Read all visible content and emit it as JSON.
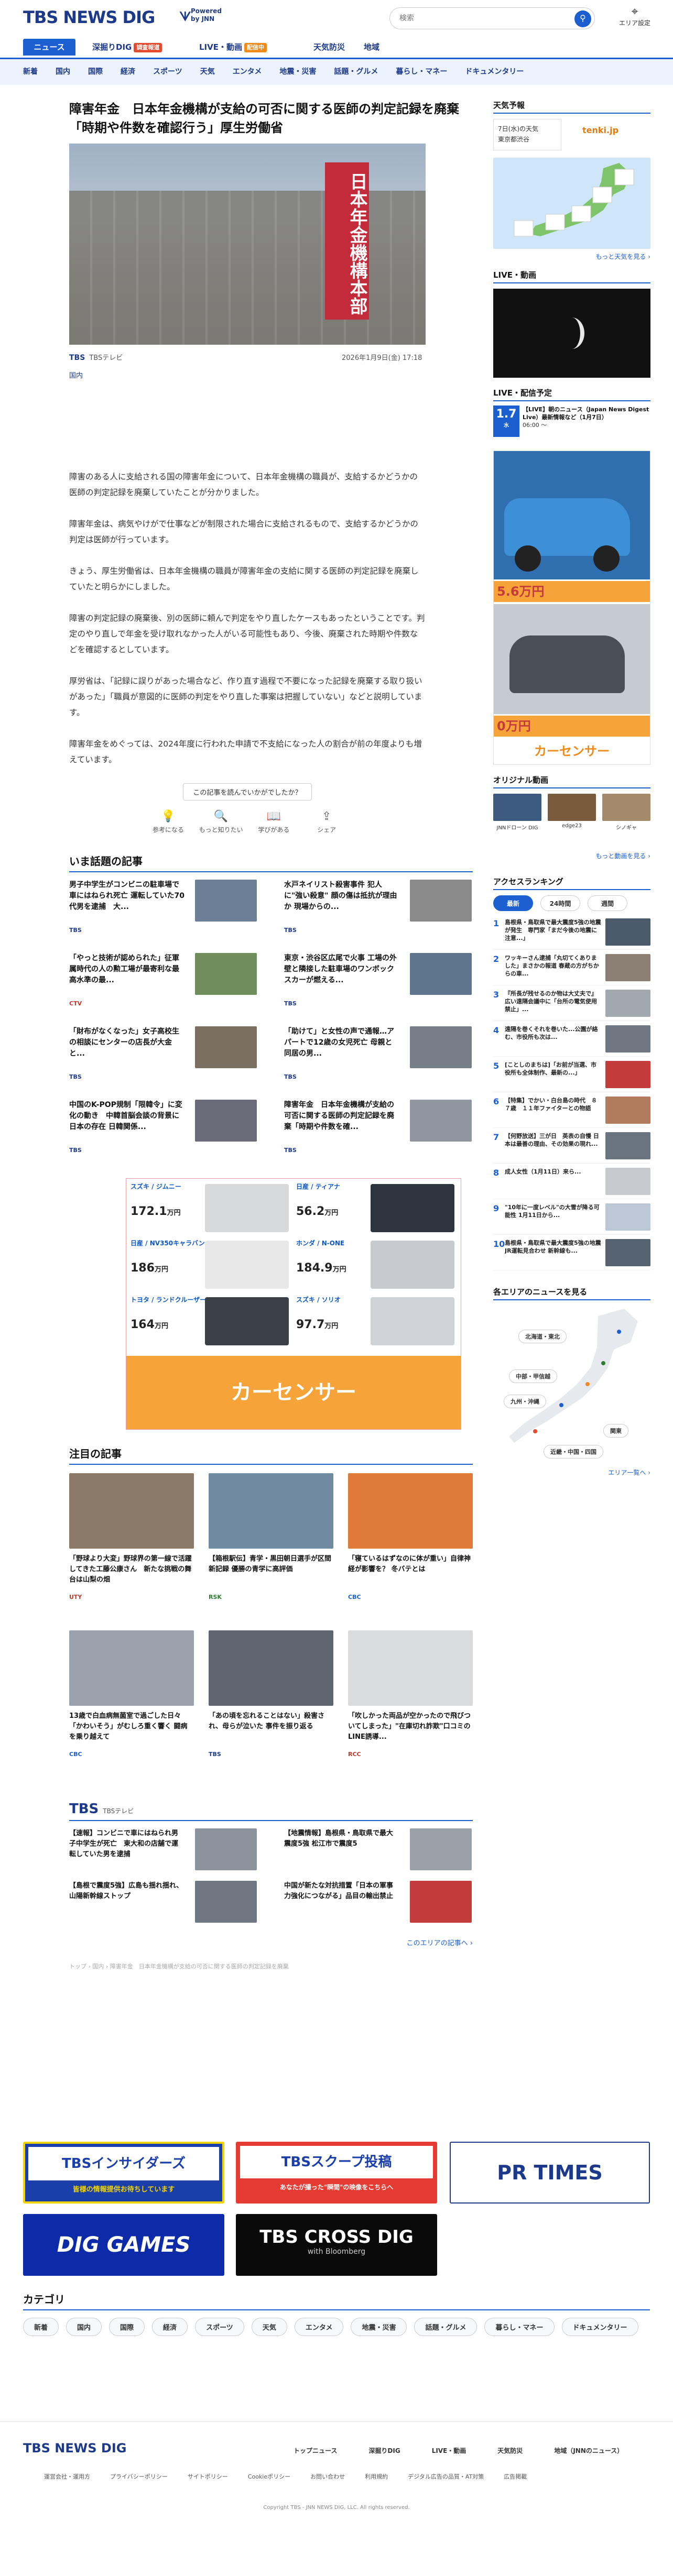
{
  "header": {
    "logo": "TBS NEWS DIG",
    "logo_sub1": "Powered",
    "logo_sub2": "by JNN",
    "search_placeholder": "検索",
    "area_label": "エリア設定",
    "nav1": [
      {
        "label": "ニュース"
      },
      {
        "label": "深掘りDIG",
        "badge": "調査報道"
      },
      {
        "label": "LIVE・動画",
        "badge": "配信中"
      },
      {
        "label": "天気防災"
      },
      {
        "label": "地域"
      }
    ],
    "nav2": [
      "新着",
      "国内",
      "国際",
      "経済",
      "スポーツ",
      "天気",
      "エンタメ",
      "地震・災害",
      "話題・グルメ",
      "暮らし・マネー",
      "ドキュメンタリー"
    ]
  },
  "article": {
    "title": "障害年金　日本年金機構が支給の可否に関する医師の判定記録を廃棄「時期や件数を確認行う」厚生労働省",
    "photo_sign": "日本年金機構本部",
    "source_logo": "TBS",
    "source": "TBSテレビ",
    "date": "2026年1月9日(金) 17:18",
    "tag": "国内",
    "paragraphs": [
      "障害のある人に支給される国の障害年金について、日本年金機構の職員が、支給するかどうかの医師の判定記録を廃棄していたことが分かりました。",
      "障害年金は、病気やけがで仕事などが制限された場合に支給されるもので、支給するかどうかの判定は医師が行っています。",
      "きょう、厚生労働省は、日本年金機構の職員が障害年金の支給に関する医師の判定記録を廃棄していたと明らかにしました。",
      "障害の判定記録の廃棄後、別の医師に頼んで判定をやり直したケースもあったということです。判定のやり直しで年金を受け取れなかった人がいる可能性もあり、今後、廃棄された時期や件数などを確認するとしています。",
      "厚労省は、「記録に誤りがあった場合など、作り直す過程で不要になった記録を廃棄する取り扱いがあった」「職員が意図的に医師の判定をやり直した事案は把握していない」などと説明しています。",
      "障害年金をめぐっては、2024年度に行われた申請で不支給になった人の割合が前の年度よりも増えています。"
    ],
    "reaction_question": "この記事を読んでいかがでしたか？",
    "reactions": [
      {
        "icon": "lightbulb-icon",
        "glyph": "💡",
        "label": "参考になる"
      },
      {
        "icon": "search-icon",
        "glyph": "🔍",
        "label": "もっと知りたい"
      },
      {
        "icon": "book-icon",
        "glyph": "📖",
        "label": "学びがある"
      },
      {
        "icon": "share-icon",
        "glyph": "⇪",
        "label": "シェア"
      }
    ]
  },
  "topics": {
    "heading": "いま話題の記事",
    "items": [
      {
        "title": "男子中学生がコンビニの駐車場で車にはねられ死亡 運転していた70代男を逮捕　大...",
        "source": "TBS",
        "time": "",
        "color": "#6d7f96",
        "src_color": "#1d3a8a"
      },
      {
        "title": "水戸ネイリスト殺害事件 犯人に\"強い殺意\" 顔の傷は抵抗が理由か 現場からの...",
        "source": "TBS",
        "time": "",
        "color": "#8a8a8a",
        "src_color": "#1d3a8a"
      },
      {
        "title": "「やっと技術が認められた」征軍属時代の人の勲工場が最寄利な最高水準の最...",
        "source": "CTV",
        "time": "",
        "color": "#6f8e5c",
        "src_color": "#c0392b"
      },
      {
        "title": "東京・渋谷区広尾で火事 工場の外壁と隣接した駐車場のワンボックスカーが燃える...",
        "source": "TBS",
        "time": "",
        "color": "#5e7590",
        "src_color": "#1d3a8a"
      },
      {
        "title": "「財布がなくなった」女子高校生の相談にセンターの店長が大金と...",
        "source": "TBS",
        "time": "",
        "color": "#7b6f62",
        "src_color": "#1d3a8a"
      },
      {
        "title": "「助けて」と女性の声で通報…アパートで12歳の女児死亡 母親と同居の男...",
        "source": "TBS",
        "time": "",
        "color": "#767e88",
        "src_color": "#1d3a8a"
      },
      {
        "title": "中国のK-POP規制「限韓令」に変化の動き　中韓首脳会談の背景に日本の存在 日韓関係...",
        "source": "TBS",
        "time": "",
        "color": "#6b6a78",
        "src_color": "#1d3a8a"
      },
      {
        "title": "障害年金　日本年金機構が支給の可否に関する医師の判定記録を廃棄「時期や件数を確...",
        "source": "TBS",
        "time": "",
        "color": "#8f96a0",
        "src_color": "#1d3a8a"
      }
    ]
  },
  "ad_main": {
    "cells": [
      {
        "name": "スズキ / ジムニー",
        "price": "172.1",
        "unit": "万円",
        "color": "#d7d9db"
      },
      {
        "name": "日産 / ティアナ",
        "price": "56.2",
        "unit": "万円",
        "color": "#2d3440"
      },
      {
        "name": "日産 / NV350キャラバン",
        "price": "186",
        "unit": "万円",
        "color": "#e8e8e8"
      },
      {
        "name": "ホンダ / N-ONE",
        "price": "184.9",
        "unit": "万円",
        "color": "#c7cbd0"
      },
      {
        "name": "トヨタ / ランドクルーザー",
        "price": "164",
        "unit": "万円",
        "color": "#3b3f46"
      },
      {
        "name": "スズキ / ソリオ",
        "price": "97.7",
        "unit": "万円",
        "color": "#cfd3d8"
      }
    ],
    "logo": "カーセンサー"
  },
  "featured": {
    "heading": "注目の記事",
    "items": [
      {
        "title": "「野球より大変」野球界の第一線で活躍してきた工藤公康さん　新たな挑戦の舞台は山梨の畑",
        "source": "UTY",
        "time": "",
        "color": "#8c7a68",
        "src_color": "#c0392b"
      },
      {
        "title": "【箱根駅伝】青学・黒田朝日選手が区間新記録 優勝の青学に高評価",
        "source": "RSK",
        "time": "",
        "color": "#6f8aa1",
        "src_color": "#2e7d32"
      },
      {
        "title": "「寝ているはずなのに体が重い」自律神経が影響を？ 冬バテとは",
        "source": "CBC",
        "time": "",
        "color": "#e07a3a",
        "src_color": "#1b5fd1"
      },
      {
        "title": "13歳で白血病無菌室で過ごした日々「かわいそう」がむしろ重く響く 闘病を乗り越えて",
        "source": "CBC",
        "time": "",
        "color": "#9aa3ad",
        "src_color": "#1b5fd1"
      },
      {
        "title": "「あの頃を忘れることはない」殺害され、母らが泣いた 事件を振り返る",
        "source": "TBS",
        "time": "",
        "color": "#5f6670",
        "src_color": "#1d3a8a"
      },
      {
        "title": "「吹しかった両品が空かったので飛びついてしまった」\"在庫切れ詐欺\"口コミのLINE誘導...",
        "source": "RCC",
        "time": "",
        "color": "#d9dbdd",
        "src_color": "#c0392b"
      }
    ]
  },
  "tbs_local": {
    "logo": "TBS",
    "label": "TBSテレビ",
    "items": [
      {
        "title": "【速報】コンビニで車にはねられ男子中学生が死亡　東大和の店舗で運転していた男を逮捕",
        "color": "#8b939c"
      },
      {
        "title": "【地震情報】島根県・鳥取県で最大震度5強 松江市で震度5",
        "color": "#9aa0a8"
      },
      {
        "title": "【島根で震度5強】広島も揺れ揺れ、山陽新幹線ストップ",
        "color": "#6e7682"
      },
      {
        "title": "中国が新たな対抗措置「日本の軍事力強化につながる」品目の輸出禁止",
        "color": "#c43b3b"
      }
    ],
    "more": "このエリアの記事へ ›"
  },
  "breadcrumb": "トップ › 国内 › 障害年金　日本年金機構が支給の可否に関する医師の判定記録を廃棄",
  "banners": [
    {
      "label": "TBSインサイダーズ",
      "sub": "皆様の情報提供お待ちしています"
    },
    {
      "label": "TBSスクープ投稿",
      "sub": "あなたが撮った\"瞬間\"の映像をこちらへ"
    },
    {
      "label": "PR TIMES",
      "sub": ""
    },
    {
      "label": "DIG GAMES",
      "sub": ""
    },
    {
      "label": "TBS CROSS DIG",
      "sub": "with Bloomberg"
    }
  ],
  "categories": {
    "heading": "カテゴリ",
    "items": [
      "新着",
      "国内",
      "国際",
      "経済",
      "スポーツ",
      "天気",
      "エンタメ",
      "地震・災害",
      "話題・グルメ",
      "暮らし・マネー",
      "ドキュメンタリー"
    ]
  },
  "footer": {
    "logo": "TBS NEWS DIG",
    "links1": [
      "トップニュース",
      "深掘りDIG",
      "LIVE・動画",
      "天気防災",
      "地域（JNNのニュース）"
    ],
    "links2": [
      "運営会社・運用方",
      "プライバシーポリシー",
      "サイトポリシー",
      "Cookieポリシー",
      "お問い合わせ",
      "利用規約",
      "デジタル広告の品質・AT対策",
      "広告掲載"
    ],
    "copyright": "Copyright TBS - JNN NEWS DIG, LLC. All rights reserved."
  },
  "sidebar": {
    "weather": {
      "heading": "天気予報",
      "tab1": "7日(水)の天気",
      "tab2": "東京都渋谷",
      "logo": "tenki.jp",
      "more": "もっと天気を見る ›"
    },
    "live": {
      "heading": "LIVE・動画",
      "sched_heading": "LIVE・配信予定",
      "sched_day": "1.7",
      "sched_wd": "水",
      "sched_title": "【LIVE】朝のニュース（Japan News Digest Live）最新情報など（1月7日）",
      "sched_time": "06:00 〜"
    },
    "originals": {
      "heading": "オリジナル動画",
      "items": [
        {
          "label": "JNNドローン DIG",
          "color": "#3d5a80"
        },
        {
          "label": "edge23",
          "color": "#7a5c3c"
        },
        {
          "label": "シノギャ",
          "color": "#a48a6a"
        }
      ],
      "more": "もっと動画を見る ›"
    },
    "ranking": {
      "heading": "アクセスランキング",
      "tabs": [
        "最新",
        "24時間",
        "週間"
      ],
      "items": [
        {
          "title": "島根県・鳥取県で最大震度5強の地震が発生　専門家「まだ今後の地震に注意...」",
          "color": "#4a5a6b"
        },
        {
          "title": "ワッキーさん逮捕「丸切てくありました」まさかの報道 春蔵の方がちからの車...",
          "color": "#8a7f72"
        },
        {
          "title": "『所長が残せるのか物は大丈夫で』広い遠隔会議中に「台所の電気使用禁止」...",
          "color": "#a3a8ae"
        },
        {
          "title": "遠隔を巻くそれを巻いた...公園が絡む、市役所も次は...",
          "color": "#6e7782"
        },
        {
          "title": "[ことしのまちは]「お前が当選、市役所も全体制作、最新の...」",
          "color": "#c43b3b"
        },
        {
          "title": "【特集】でかい・白台島の時代　８７歳　１１年ファイターとの物語",
          "color": "#b37b5e"
        },
        {
          "title": "【何野放送】三が日　英表の自慢 日本は最善の理由、その効果の現れ...",
          "color": "#6a7380"
        },
        {
          "title": "成人女性（1月11日）来ら...",
          "color": "#c7cbcf"
        },
        {
          "title": "\"10年に一度レベル\"の大雪が降る可能性 1月11日から...",
          "color": "#bcc8d6"
        },
        {
          "title": "島根県・鳥取県で最大震度5強の地震 JR運転見合わせ 新幹線も...",
          "color": "#55626f"
        }
      ]
    },
    "areas": {
      "heading": "各エリアのニュースを見る",
      "pills": [
        "北海道・東北",
        "中部・甲信越",
        "九州・沖縄",
        "関東",
        "近畿・中国・四国"
      ],
      "more": "エリア一覧へ ›"
    }
  }
}
